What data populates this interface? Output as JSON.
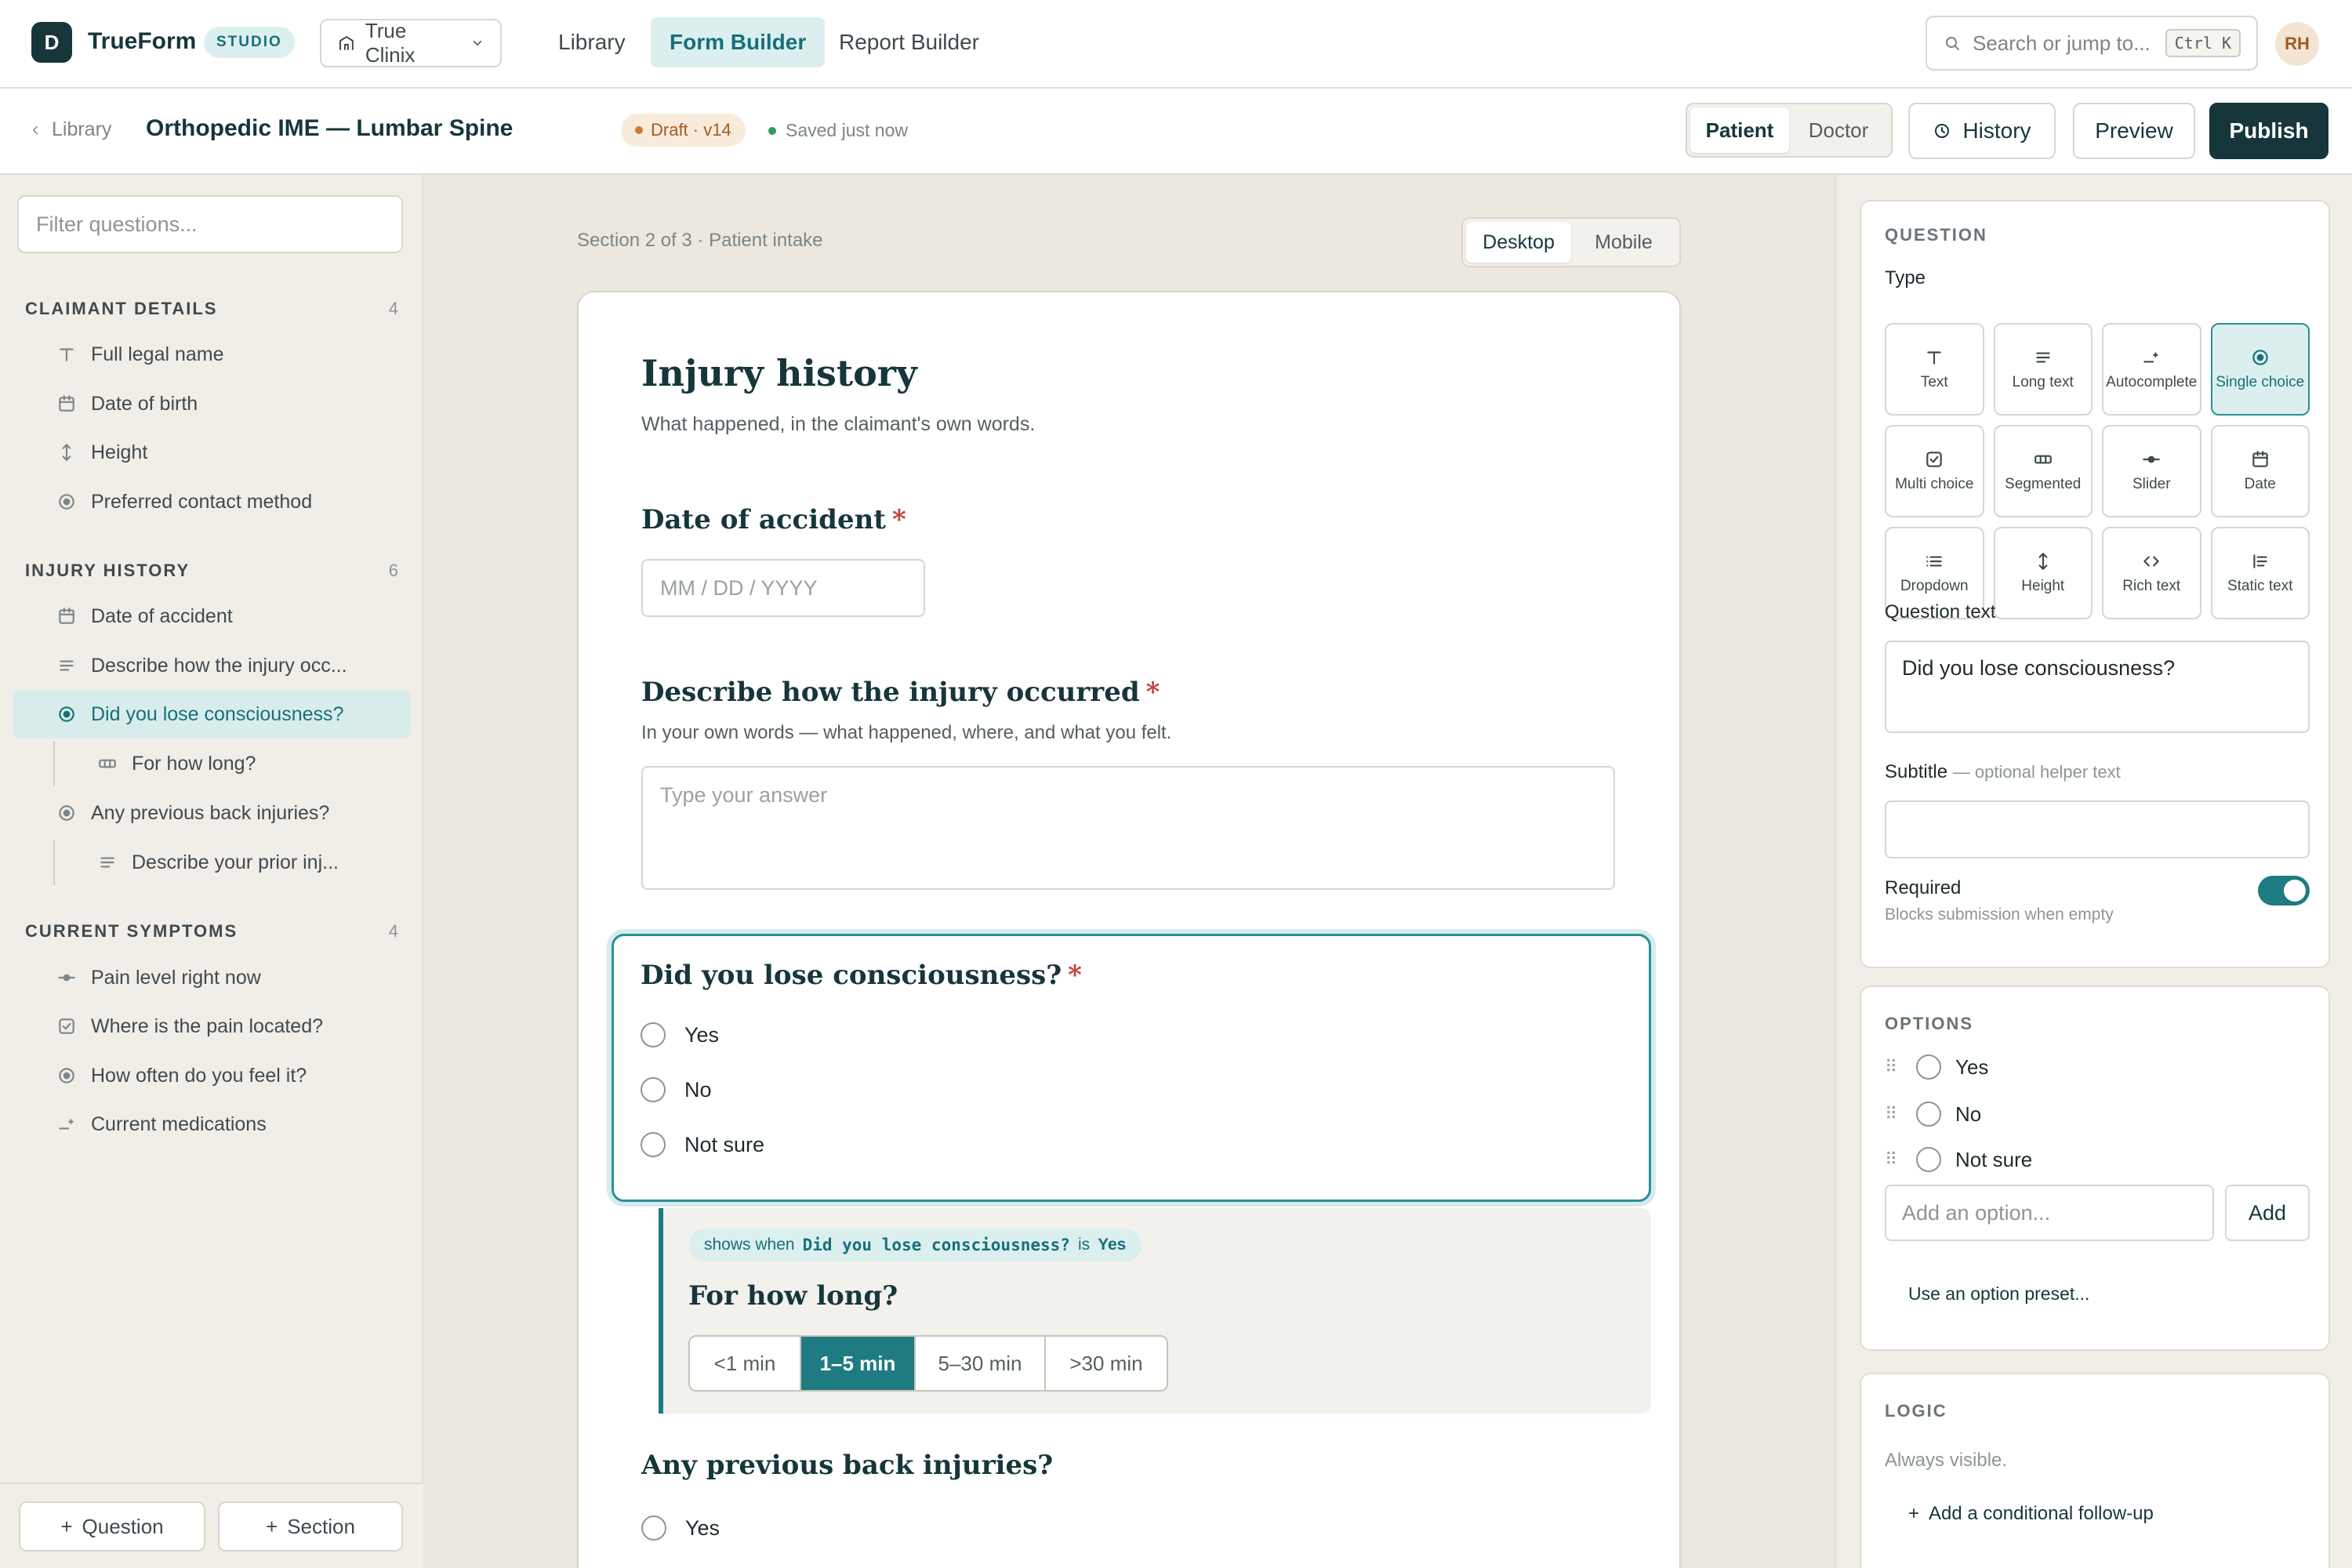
{
  "topbar": {
    "logo_letter": "D",
    "brand": "TrueForm",
    "studio_badge": "STUDIO",
    "clinic": "True Clinix",
    "nav": [
      "Library",
      "Form Builder",
      "Report Builder"
    ],
    "search_placeholder": "Search or jump to...",
    "shortcut": "Ctrl K",
    "avatar": "RH"
  },
  "subbar": {
    "back": "Library",
    "title": "Orthopedic IME — Lumbar Spine",
    "draft": "Draft · v14",
    "saved": "Saved just now",
    "view_patient": "Patient",
    "view_doctor": "Doctor",
    "history": "History",
    "preview": "Preview",
    "publish": "Publish"
  },
  "sidebar": {
    "filter_placeholder": "Filter questions...",
    "groups": [
      {
        "title": "CLAIMANT DETAILS",
        "count": "4",
        "items": [
          "Full legal name",
          "Date of birth",
          "Height",
          "Preferred contact method"
        ]
      },
      {
        "title": "INJURY HISTORY",
        "count": "6",
        "items": [
          "Date of accident",
          "Describe how the injury occ...",
          "Did you lose consciousness?",
          "For how long?",
          "Any previous back injuries?",
          "Describe your prior inj..."
        ]
      },
      {
        "title": "CURRENT SYMPTOMS",
        "count": "4",
        "items": [
          "Pain level right now",
          "Where is the pain located?",
          "How often do you feel it?",
          "Current medications"
        ]
      }
    ],
    "add_question": "Question",
    "add_section": "Section"
  },
  "canvas": {
    "section_label": "Section 2 of 3 · Patient intake",
    "device_desktop": "Desktop",
    "device_mobile": "Mobile",
    "form": {
      "title": "Injury history",
      "subtitle": "What happened, in the claimant's own words.",
      "q1_label": "Date of accident",
      "q1_placeholder": "MM / DD / YYYY",
      "q2_label": "Describe how the injury occurred",
      "q2_help": "In your own words — what happened, where, and what you felt.",
      "q2_placeholder": "Type your answer",
      "q3_label": "Did you lose consciousness?",
      "q3_options": [
        "Yes",
        "No",
        "Not sure"
      ],
      "cond_prefix": "shows when",
      "cond_question": "Did you lose consciousness?",
      "cond_is": "is",
      "cond_value": "Yes",
      "q4_label": "For how long?",
      "q4_segments": [
        "<1 min",
        "1–5 min",
        "5–30 min",
        ">30 min"
      ],
      "q4_selected": "1–5 min",
      "q5_label": "Any previous back injuries?",
      "q5_options": [
        "Yes"
      ],
      "required_mark": "*"
    }
  },
  "panel": {
    "question_heading": "QUESTION",
    "type_label": "Type",
    "types": [
      "Text",
      "Long text",
      "Autocomplete",
      "Single choice",
      "Multi choice",
      "Segmented",
      "Slider",
      "Date",
      "Dropdown",
      "Height",
      "Rich text",
      "Static text"
    ],
    "selected_type": "Single choice",
    "question_text_label": "Question text",
    "question_text": "Did you lose consciousness?",
    "subtitle_label": "Subtitle",
    "subtitle_hint": "— optional helper text",
    "required_label": "Required",
    "required_hint": "Blocks submission when empty",
    "options_heading": "OPTIONS",
    "options": [
      "Yes",
      "No",
      "Not sure"
    ],
    "add_option_placeholder": "Add an option...",
    "add_button": "Add",
    "preset_link": "Use an option preset...",
    "logic_heading": "LOGIC",
    "logic_status": "Always visible.",
    "logic_add": "Add a conditional follow-up"
  },
  "colors": {
    "accent": "#1f7b82",
    "brand_dark": "#16363b",
    "required": "#c2413a",
    "draft": "#d37a2c",
    "saved": "#2e9c5c"
  }
}
